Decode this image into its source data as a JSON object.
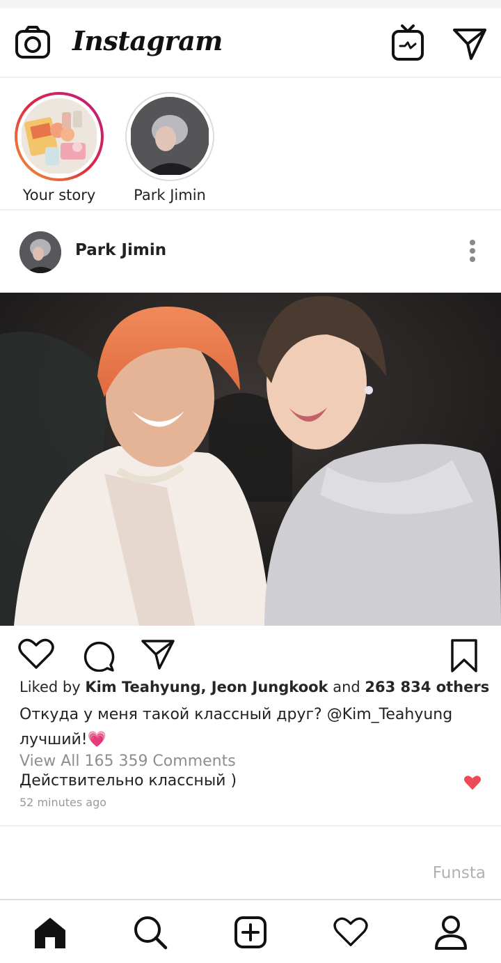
{
  "app": {
    "title": "Instagram"
  },
  "stories": [
    {
      "name": "Your story"
    },
    {
      "name": "Park Jimin"
    }
  ],
  "post": {
    "username": "Park Jimin",
    "likes": {
      "prefix": "Liked by",
      "names": "Kim Teahyung, Jeon Jungkook",
      "and": "and",
      "count": "263 834 others"
    },
    "caption": "Откуда у меня такой классный друг? @Kim_Teahyung лучший!💗",
    "view_all_comments": "View All 165 359 Comments",
    "top_comment": "Действительно классный )",
    "timestamp": "52 minutes ago"
  },
  "watermark": "Funsta",
  "icons": {
    "camera": "camera-icon",
    "igtv": "igtv-icon",
    "direct": "direct-message-icon",
    "like": "heart-icon",
    "comment": "comment-icon",
    "share": "share-icon",
    "save": "bookmark-icon",
    "home": "home-icon",
    "search": "search-icon",
    "add": "add-post-icon",
    "activity": "activity-heart-icon",
    "profile": "profile-icon"
  },
  "colors": {
    "story_ring": "#dc2743",
    "liked_heart": "#ed4956",
    "muted_text": "#8e8e8e"
  }
}
